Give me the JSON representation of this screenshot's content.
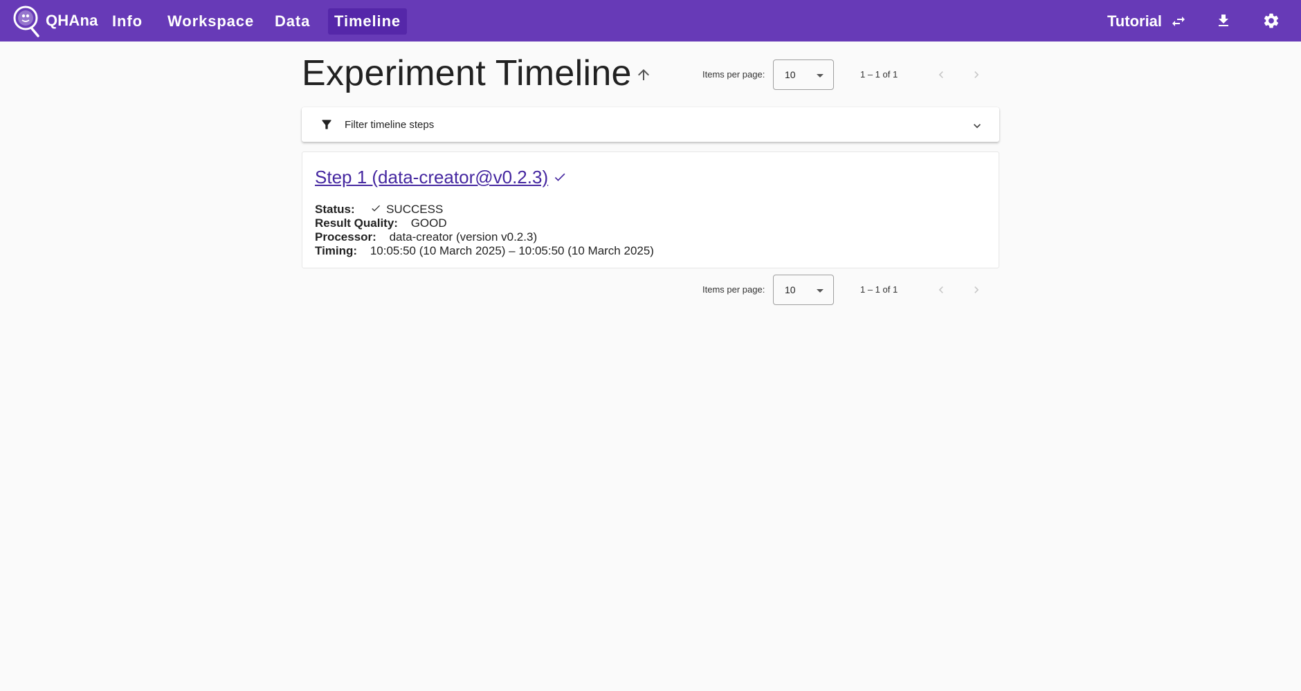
{
  "topbar": {
    "brand": "QHAna",
    "nav": [
      {
        "label": "Info"
      },
      {
        "label": "Workspace"
      },
      {
        "label": "Data"
      },
      {
        "label": "Timeline"
      }
    ],
    "tutorial_label": "Tutorial",
    "colors": {
      "bar": "#673ab7",
      "active": "#5527a9"
    }
  },
  "page": {
    "title": "Experiment Timeline"
  },
  "paginator": {
    "items_per_page_label": "Items per page:",
    "page_size": "10",
    "range": "1 – 1 of 1"
  },
  "filter": {
    "label": "Filter timeline steps"
  },
  "step": {
    "title": "Step 1 (data-creator@v0.2.3)",
    "status_label": "Status:",
    "status_value": "SUCCESS",
    "quality_label": "Result Quality:",
    "quality_value": "GOOD",
    "processor_label": "Processor:",
    "processor_value": "data-creator (version v0.2.3)",
    "timing_label": "Timing:",
    "timing_value": "10:05:50 (10 March 2025) – 10:05:50 (10 March 2025)"
  }
}
